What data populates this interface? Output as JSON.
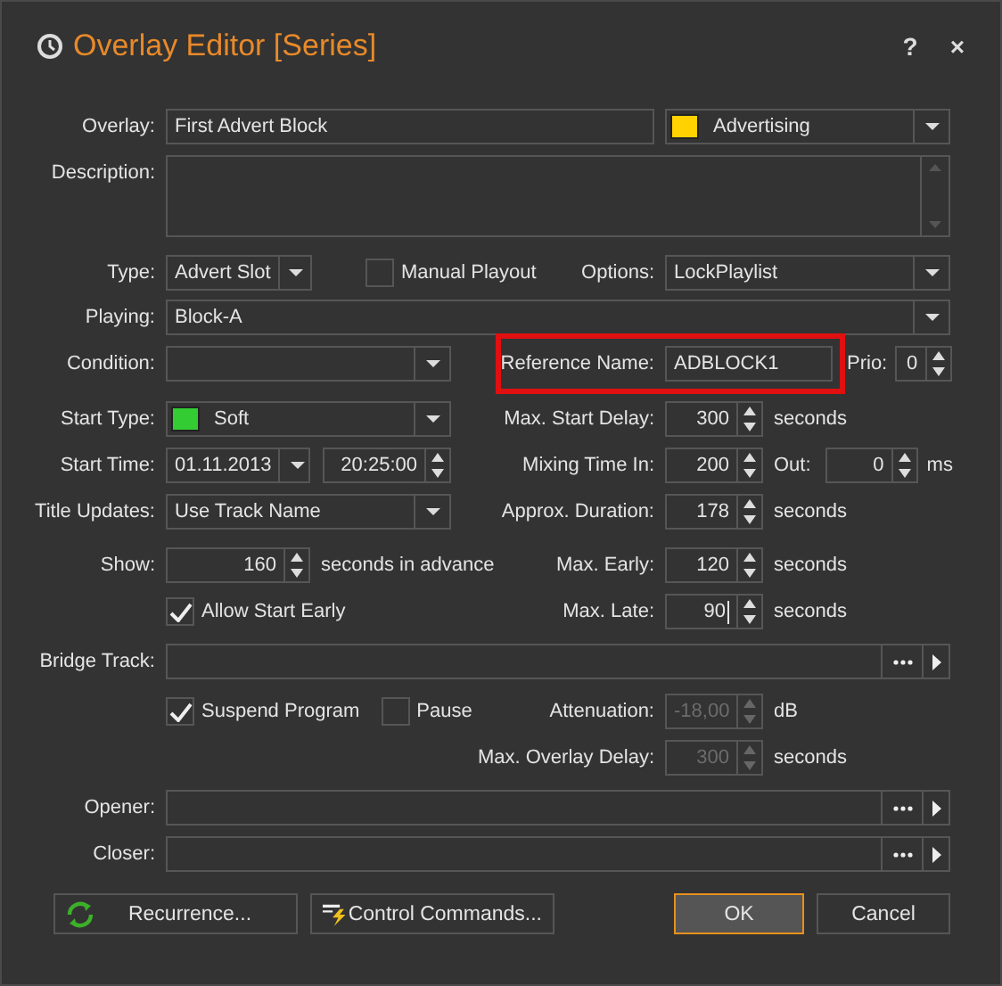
{
  "window": {
    "title": "Overlay Editor [Series]",
    "buttons": [
      "?",
      "×"
    ]
  },
  "overlay": {
    "label": "Overlay:",
    "value": "First Advert Block"
  },
  "category": {
    "value": "Advertising",
    "color": "#ffd200"
  },
  "description": {
    "label": "Description:"
  },
  "type": {
    "label": "Type:",
    "value": "Advert Slot"
  },
  "manual_playout": {
    "label": "Manual Playout",
    "checked": false
  },
  "options": {
    "label": "Options:",
    "value": "LockPlaylist"
  },
  "playing": {
    "label": "Playing:",
    "value": "Block-A"
  },
  "condition": {
    "label": "Condition:"
  },
  "reference_name": {
    "label": "Reference Name:",
    "value": "ADBLOCK1",
    "highlighted": true
  },
  "prio": {
    "label": "Prio:",
    "value": "0"
  },
  "start_type": {
    "label": "Start Type:",
    "value": "Soft",
    "color": "#33cc33"
  },
  "max_start_delay": {
    "label": "Max. Start Delay:",
    "value": "300",
    "unit": "seconds"
  },
  "start_time": {
    "label": "Start Time:",
    "date": "01.11.2013",
    "time": "20:25:00"
  },
  "mixing_time_in": {
    "label": "Mixing Time In:",
    "value": "200"
  },
  "mixing_time_out": {
    "label": "Out:",
    "value": "0",
    "unit": "ms"
  },
  "title_updates": {
    "label": "Title Updates:",
    "value": "Use Track Name"
  },
  "approx_duration": {
    "label": "Approx. Duration:",
    "value": "178",
    "unit": "seconds"
  },
  "show": {
    "label": "Show:",
    "value": "160",
    "unit": "seconds in advance"
  },
  "max_early": {
    "label": "Max. Early:",
    "value": "120",
    "unit": "seconds"
  },
  "allow_start_early": {
    "label": "Allow Start Early",
    "checked": true
  },
  "max_late": {
    "label": "Max. Late:",
    "value": "90",
    "unit": "seconds",
    "focused": true
  },
  "bridge_track": {
    "label": "Bridge Track:"
  },
  "suspend_program": {
    "label": "Suspend Program",
    "checked": true
  },
  "pause": {
    "label": "Pause",
    "checked": false
  },
  "attenuation": {
    "label": "Attenuation:",
    "value": "-18,00",
    "unit": "dB",
    "disabled": true
  },
  "max_overlay_delay": {
    "label": "Max. Overlay Delay:",
    "value": "300",
    "unit": "seconds",
    "disabled": true
  },
  "opener": {
    "label": "Opener:"
  },
  "closer": {
    "label": "Closer:"
  },
  "buttons": [
    {
      "label": "Recurrence...",
      "kind": "recurrence"
    },
    {
      "label": "Control Commands...",
      "kind": "commands"
    },
    {
      "label": "OK",
      "kind": "default"
    },
    {
      "label": "Cancel",
      "kind": "plain"
    }
  ]
}
